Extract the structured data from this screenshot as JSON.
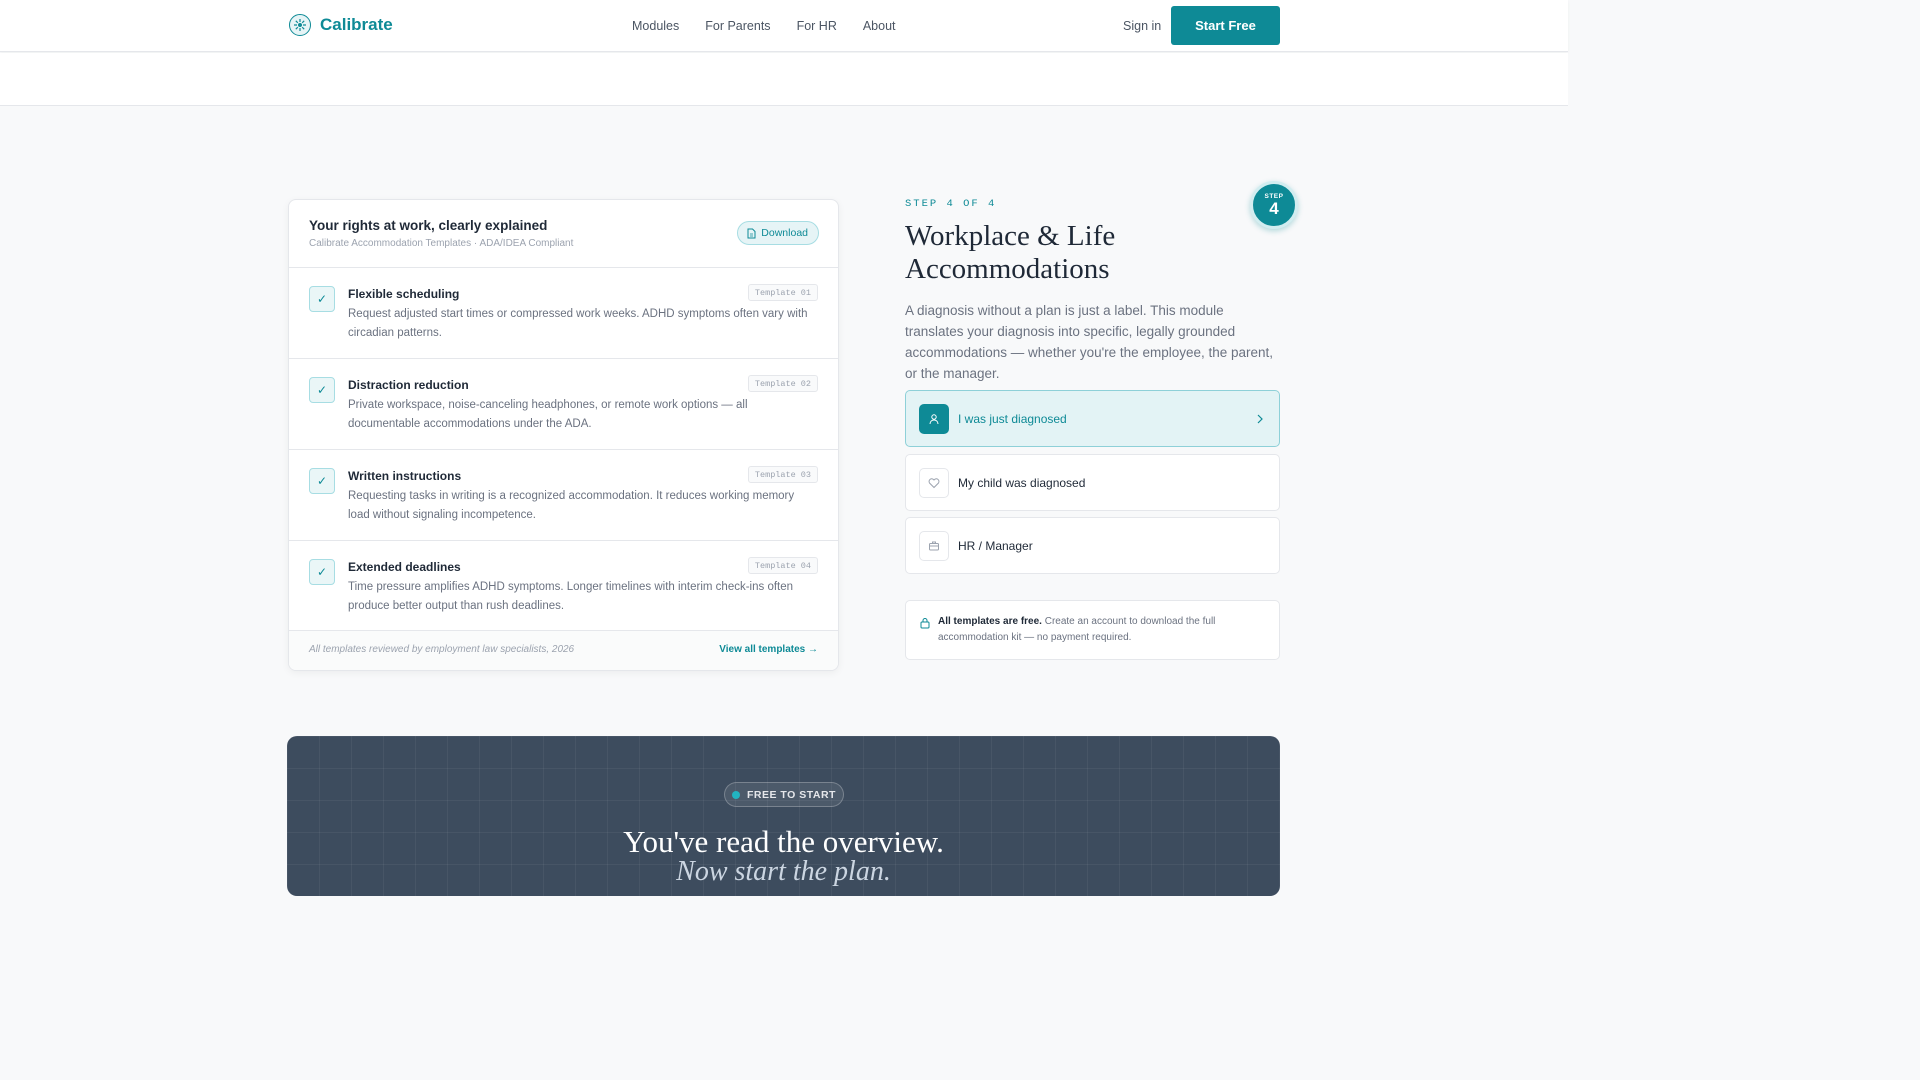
{
  "header": {
    "brand": "Calibrate",
    "nav": [
      "Modules",
      "For Parents",
      "For HR",
      "About"
    ],
    "signin": "Sign in",
    "cta": "Start Free"
  },
  "card": {
    "title": "Your rights at work, clearly explained",
    "subtitle": "Calibrate Accommodation Templates · ADA/IDEA Compliant",
    "download": "Download",
    "items": [
      {
        "title": "Flexible scheduling",
        "desc": "Request adjusted start times or compressed work weeks. ADHD symptoms often vary with circadian patterns.",
        "tag": "Template 01"
      },
      {
        "title": "Distraction reduction",
        "desc": "Private workspace, noise-canceling headphones, or remote work options — all documentable accommodations under the ADA.",
        "tag": "Template 02"
      },
      {
        "title": "Written instructions",
        "desc": "Requesting tasks in writing is a recognized accommodation. It reduces working memory load without signaling incompetence.",
        "tag": "Template 03"
      },
      {
        "title": "Extended deadlines",
        "desc": "Time pressure amplifies ADHD symptoms. Longer timelines with interim check-ins often produce better output than rush deadlines.",
        "tag": "Template 04"
      }
    ],
    "footnote": "All templates reviewed by employment law specialists, 2026",
    "view_all": "View all templates"
  },
  "module": {
    "step_label": "STEP 4 OF 4",
    "badge_label": "STEP",
    "badge_number": "4",
    "heading": "Workplace & Life Accommodations",
    "lead": "A diagnosis without a plan is just a label. This module translates your diagnosis into specific, legally grounded accommodations — whether you're the employee, the parent, or the manager.",
    "options": [
      {
        "label": "I was just diagnosed",
        "icon": "user-icon",
        "active": true
      },
      {
        "label": "My child was diagnosed",
        "icon": "heart-icon",
        "active": false
      },
      {
        "label": "HR / Manager",
        "icon": "briefcase-icon",
        "active": false
      }
    ],
    "note_bold": "All templates are free.",
    "note_rest": " Create an account to download the full accommodation kit — no payment required."
  },
  "cta": {
    "pill": "FREE TO START",
    "line1": "You've read the overview.",
    "line2": "Now start the plan."
  },
  "colors": {
    "accent": "#0e8a96",
    "cta_bg": "#3d4c5e"
  }
}
